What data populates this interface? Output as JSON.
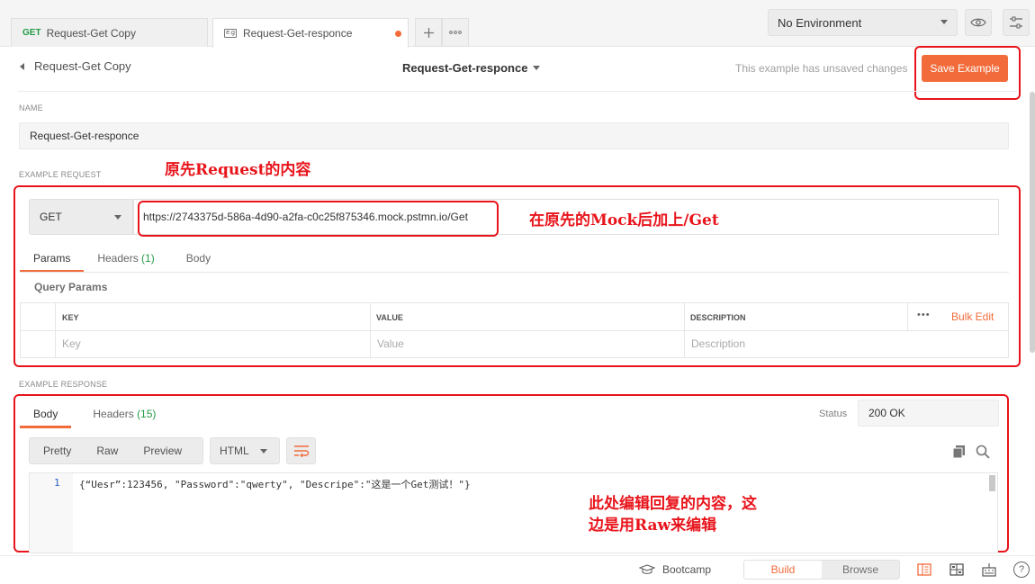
{
  "tabs": [
    {
      "method": "GET",
      "label": "Request-Get Copy"
    },
    {
      "icon": "example-icon",
      "label": "Request-Get-responce",
      "unsaved": true
    }
  ],
  "environment": {
    "selected": "No Environment"
  },
  "header": {
    "back_label": "Request-Get Copy",
    "example_title": "Request-Get-responce",
    "unsaved_text": "This example has unsaved changes",
    "save_label": "Save Example"
  },
  "name_section": {
    "label": "NAME",
    "value": "Request-Get-responce"
  },
  "request": {
    "section_label": "EXAMPLE REQUEST",
    "method": "GET",
    "url": "https://2743375d-586a-4d90-a2fa-c0c25f875346.mock.pstmn.io/Get",
    "tabs": [
      {
        "label": "Params"
      },
      {
        "label": "Headers",
        "count": "(1)"
      },
      {
        "label": "Body"
      }
    ],
    "query_params_label": "Query Params",
    "columns": [
      "KEY",
      "VALUE",
      "DESCRIPTION"
    ],
    "placeholders": [
      "Key",
      "Value",
      "Description"
    ],
    "more_label": "•••",
    "bulk_edit_label": "Bulk Edit"
  },
  "response": {
    "section_label": "EXAMPLE RESPONSE",
    "tabs": [
      {
        "label": "Body"
      },
      {
        "label": "Headers",
        "count": "(15)"
      }
    ],
    "status_label": "Status",
    "status_value": "200 OK",
    "view_modes": [
      "Pretty",
      "Raw",
      "Preview"
    ],
    "format": "HTML",
    "line_number": "1",
    "code": "{“Uesr”:123456, \"Password\":\"qwerty\", \"Descripe\":\"这是一个Get测试！\"}"
  },
  "annotations": {
    "request": "原先Request的内容",
    "url": "在原先的Mock后加上/Get",
    "response_line1": "此处编辑回复的内容，这",
    "response_line2": "边是用Raw来编辑"
  },
  "footer": {
    "bootcamp_label": "Bootcamp",
    "build_label": "Build",
    "browse_label": "Browse",
    "help_label": "?"
  },
  "colors": {
    "accent": "#f26b3a",
    "annotation": "#e8141b",
    "get_method": "#249c47"
  }
}
